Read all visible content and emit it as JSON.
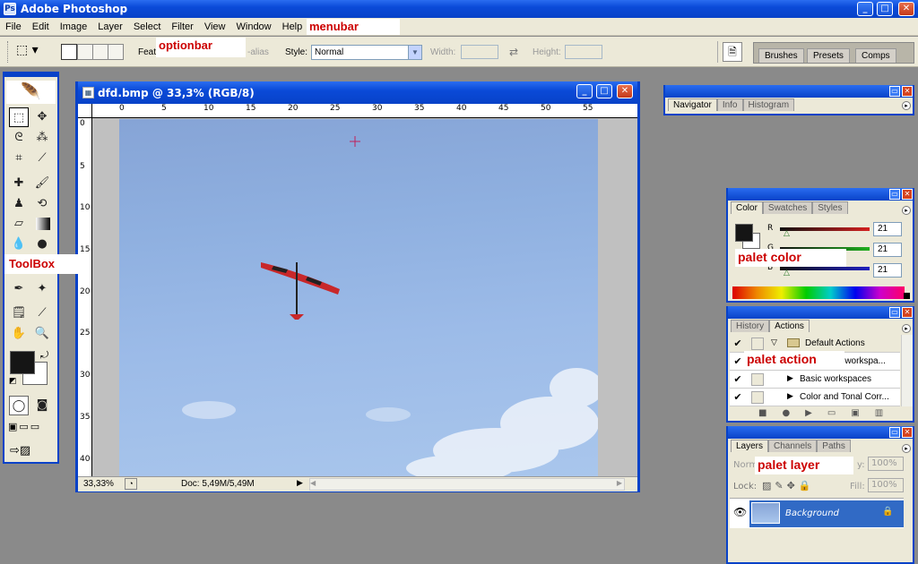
{
  "app": {
    "title": "Adobe Photoshop",
    "icon_letter": "Ps"
  },
  "window_buttons": {
    "minimize": "_",
    "maximize": "□",
    "close": "✕"
  },
  "menubar": {
    "items": [
      "File",
      "Edit",
      "Image",
      "Layer",
      "Select",
      "Filter",
      "View",
      "Window",
      "Help"
    ],
    "annotation": "menubar"
  },
  "optionbar": {
    "annotation": "optionbar",
    "feather_label": "Feath",
    "antialias_label": "-alias",
    "style_label": "Style:",
    "style_value": "Normal",
    "width_label": "Width:",
    "height_label": "Height:",
    "wells": [
      "Brushes",
      "Presets",
      "Comps"
    ]
  },
  "toolbox": {
    "annotation": "ToolBox"
  },
  "document": {
    "title": "dfd.bmp @ 33,3% (RGB/8)",
    "ruler_top": [
      "0",
      "5",
      "10",
      "15",
      "20",
      "25",
      "30",
      "35",
      "40",
      "45",
      "50",
      "55"
    ],
    "ruler_left": [
      "0",
      "5",
      "10",
      "15",
      "20",
      "25",
      "30",
      "35",
      "40"
    ],
    "zoom": "33,33%",
    "doc_size": "Doc: 5,49M/5,49M"
  },
  "navigator": {
    "tabs": [
      "Navigator",
      "Info",
      "Histogram"
    ]
  },
  "color_palette": {
    "tabs": [
      "Color",
      "Swatches",
      "Styles"
    ],
    "annotation": "palet color",
    "channels": [
      {
        "label": "R",
        "value": "21",
        "color": "#d42020"
      },
      {
        "label": "G",
        "value": "21",
        "color": "#20b020"
      },
      {
        "label": "B",
        "value": "21",
        "color": "#2020c0"
      }
    ]
  },
  "actions_palette": {
    "tabs": [
      "History",
      "Actions"
    ],
    "annotation": "palet action",
    "rows": [
      "Default Actions",
      "n workspa...",
      "Basic workspaces",
      "Color and Tonal Corr..."
    ]
  },
  "layers_palette": {
    "tabs": [
      "Layers",
      "Channels",
      "Paths"
    ],
    "annotation": "palet layer",
    "blend_mode": "Norm",
    "opacity_label": "y:",
    "opacity": "100%",
    "lock_label": "Lock:",
    "fill_label": "Fill:",
    "fill": "100%",
    "layer_name": "Background"
  },
  "colors": {
    "title_blue": "#0842c8",
    "chrome": "#ece9d8",
    "annotation_red": "#cc0000",
    "foreground": "#151515"
  }
}
